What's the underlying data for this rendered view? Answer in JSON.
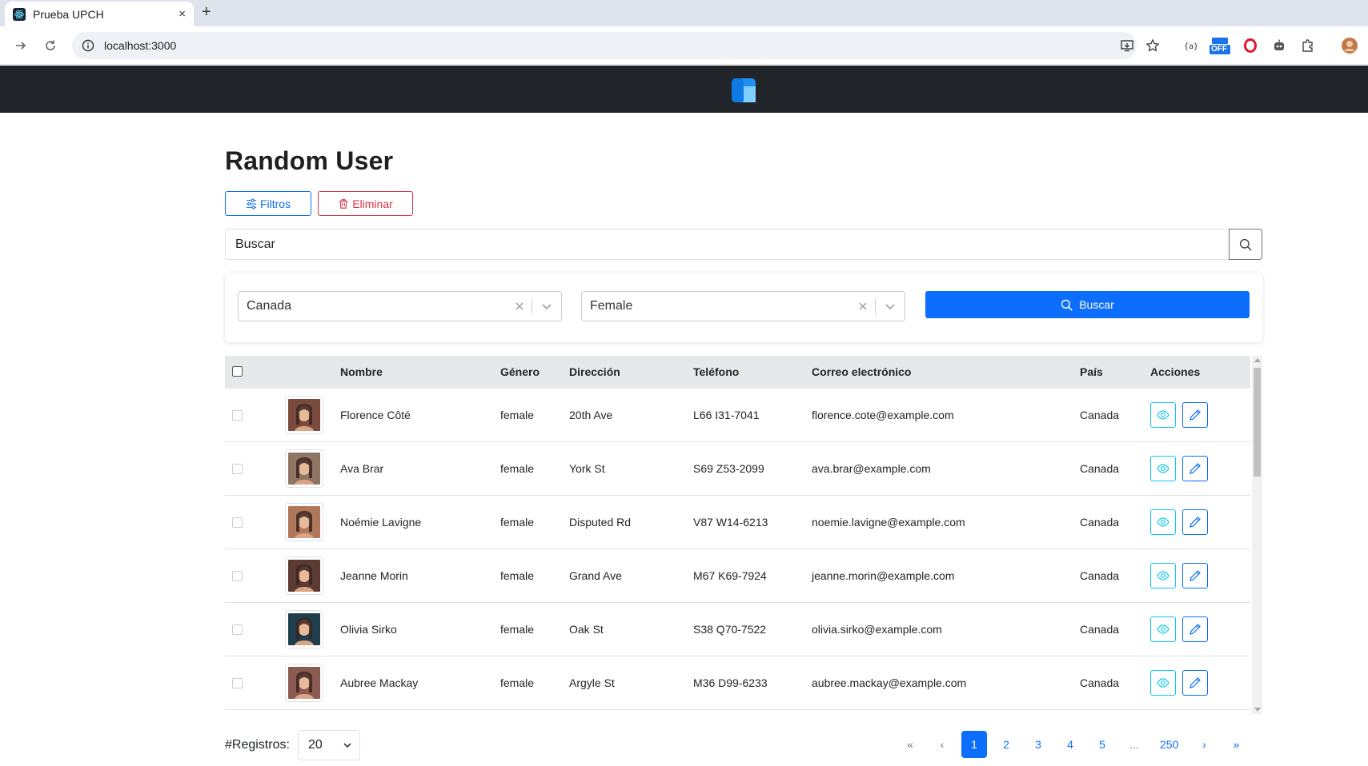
{
  "browser": {
    "tab_title": "Prueba UPCH",
    "tab_close": "×",
    "new_tab": "+",
    "url": "localhost:3000",
    "extension_badge": "OFF"
  },
  "page": {
    "title": "Random User",
    "filters_button": "Filtros",
    "delete_button": "Eliminar",
    "search_placeholder": "Buscar"
  },
  "filters": {
    "country": "Canada",
    "gender": "Female",
    "search_button": "Buscar"
  },
  "table": {
    "headers": {
      "name": "Nombre",
      "gender": "Género",
      "address": "Dirección",
      "phone": "Teléfono",
      "email": "Correo electrónico",
      "country": "País",
      "actions": "Acciones"
    },
    "rows": [
      {
        "name": "Florence Côté",
        "gender": "female",
        "address": "20th Ave",
        "phone": "L66 I31-7041",
        "email": "florence.cote@example.com",
        "country": "Canada",
        "avatar_color": "#7a4b3d"
      },
      {
        "name": "Ava Brar",
        "gender": "female",
        "address": "York St",
        "phone": "S69 Z53-2099",
        "email": "ava.brar@example.com",
        "country": "Canada",
        "avatar_color": "#8f7664"
      },
      {
        "name": "Noémie Lavigne",
        "gender": "female",
        "address": "Disputed Rd",
        "phone": "V87 W14-6213",
        "email": "noemie.lavigne@example.com",
        "country": "Canada",
        "avatar_color": "#b0775a"
      },
      {
        "name": "Jeanne Morin",
        "gender": "female",
        "address": "Grand Ave",
        "phone": "M67 K69-7924",
        "email": "jeanne.morin@example.com",
        "country": "Canada",
        "avatar_color": "#5c3b35"
      },
      {
        "name": "Olivia Sirko",
        "gender": "female",
        "address": "Oak St",
        "phone": "S38 Q70-7522",
        "email": "olivia.sirko@example.com",
        "country": "Canada",
        "avatar_color": "#1f3d4a"
      },
      {
        "name": "Aubree Mackay",
        "gender": "female",
        "address": "Argyle St",
        "phone": "M36 D99-6233",
        "email": "aubree.mackay@example.com",
        "country": "Canada",
        "avatar_color": "#8b5a52"
      }
    ]
  },
  "footer": {
    "records_label": "#Registros:",
    "records_value": "20",
    "pagination": {
      "first": "«",
      "prev": "‹",
      "pages": [
        "1",
        "2",
        "3",
        "4",
        "5"
      ],
      "ellipsis": "...",
      "last_page": "250",
      "next": "›",
      "last": "»",
      "active": "1"
    }
  },
  "colors": {
    "primary": "#0d6efd",
    "danger": "#dc3545",
    "info": "#0dcaf0",
    "navbar": "#212529"
  }
}
